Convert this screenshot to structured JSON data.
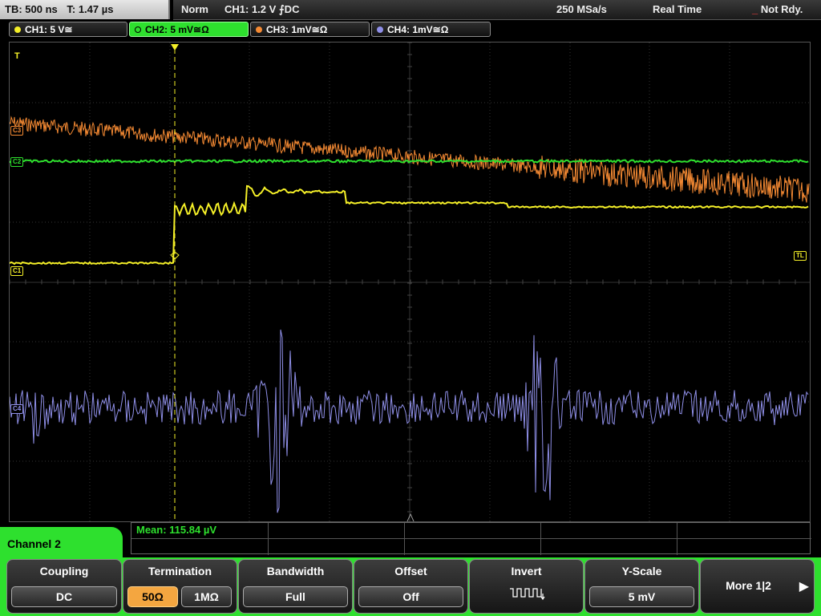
{
  "header": {
    "timebase": "TB: 500 ns",
    "trigger_time": "T: 1.47 µs",
    "mode": "Norm",
    "trigger": "CH1: 1.2 V ⨍DC",
    "sample_rate": "250 MSa/s",
    "acq_mode": "Real Time",
    "status_indicator": "_",
    "status": "Not Rdy."
  },
  "channels": [
    {
      "label": "CH1: 5 V≅",
      "color": "#f5f028"
    },
    {
      "label": "CH2: 5 mV≅Ω",
      "color": "#2ee02e"
    },
    {
      "label": "CH3: 1mV≅Ω",
      "color": "#f58a33"
    },
    {
      "label": "CH4: 1mV≅Ω",
      "color": "#8f8fe8"
    }
  ],
  "markers": {
    "c3": "C3",
    "c2": "C2",
    "c1": "C1",
    "c4": "C4",
    "tl": "TL",
    "trigger_t": "T"
  },
  "measurement": {
    "mean": "Mean: 115.84 µV"
  },
  "menu": {
    "title": "Channel 2",
    "coupling": {
      "label": "Coupling",
      "value": "DC"
    },
    "termination": {
      "label": "Termination",
      "opt1": "50Ω",
      "opt2": "1MΩ"
    },
    "bandwidth": {
      "label": "Bandwidth",
      "value": "Full"
    },
    "offset": {
      "label": "Offset",
      "value": "Off"
    },
    "invert": {
      "label": "Invert",
      "icon": "inverted-square-wave-icon"
    },
    "yscale": {
      "label": "Y-Scale",
      "value": "5 mV"
    },
    "more": {
      "label": "More 1|2",
      "icon": "right-arrow-icon"
    }
  }
}
